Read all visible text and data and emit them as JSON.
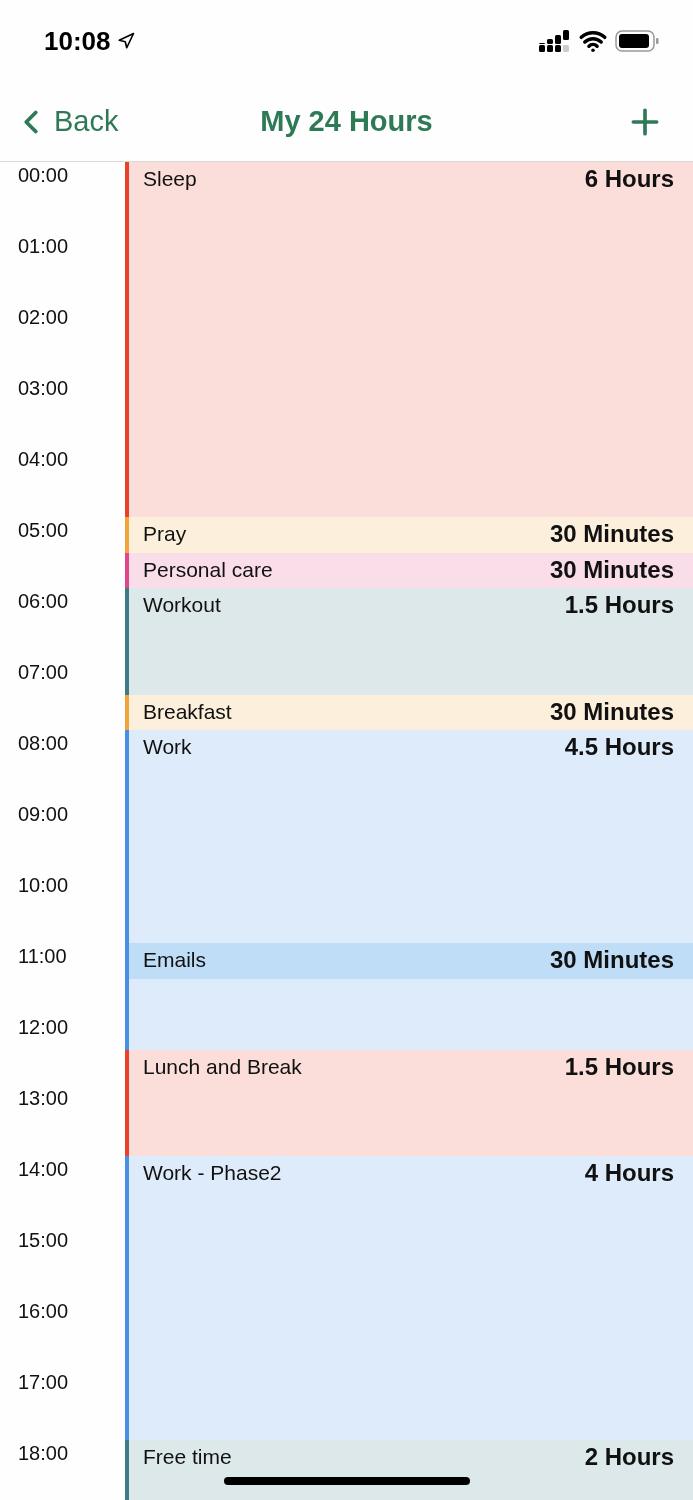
{
  "status_bar": {
    "time": "10:08"
  },
  "nav": {
    "back": "Back",
    "title": "My 24 Hours"
  },
  "hours": [
    "00:00",
    "01:00",
    "02:00",
    "03:00",
    "04:00",
    "05:00",
    "06:00",
    "07:00",
    "08:00",
    "09:00",
    "10:00",
    "11:00",
    "12:00",
    "13:00",
    "14:00",
    "15:00",
    "16:00",
    "17:00",
    "18:00"
  ],
  "events": [
    {
      "title": "Sleep",
      "duration": "6 Hours",
      "color": "#e8412c"
    },
    {
      "title": "Pray",
      "duration": "30 Minutes",
      "color": "#f0a43a"
    },
    {
      "title": "Personal care",
      "duration": "30 Minutes",
      "color": "#e0478a"
    },
    {
      "title": "Workout",
      "duration": "1.5 Hours",
      "color": "#3a7d86"
    },
    {
      "title": "Breakfast",
      "duration": "30 Minutes",
      "color": "#f0a43a"
    },
    {
      "title": "Work",
      "duration": "4.5 Hours",
      "color": "#4a8fe6",
      "nested": [
        {
          "title": "Emails",
          "duration": "30 Minutes",
          "color": "#c0ddf8"
        }
      ]
    },
    {
      "title": "Lunch and Break",
      "duration": "1.5 Hours",
      "color": "#e8412c"
    },
    {
      "title": "Work - Phase2",
      "duration": "4 Hours",
      "color": "#4a8fe6"
    },
    {
      "title": "Free time",
      "duration": "2 Hours",
      "color": "#3a7d86"
    }
  ]
}
